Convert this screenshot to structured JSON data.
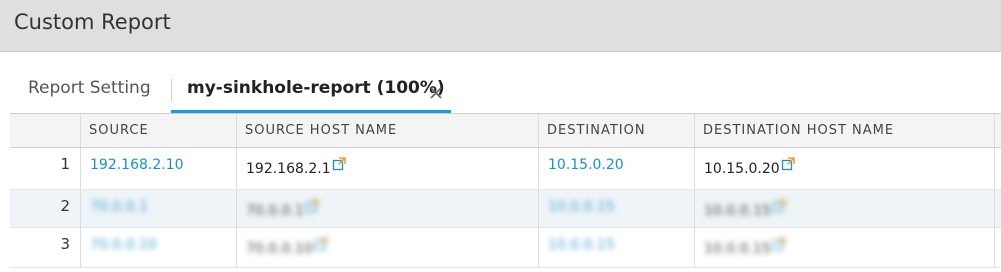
{
  "window": {
    "title": "Custom Report"
  },
  "tabs": {
    "settings_label": "Report Setting",
    "report_label": "my-sinkhole-report (100%)"
  },
  "table": {
    "columns": [
      "SOURCE",
      "SOURCE HOST NAME",
      "DESTINATION",
      "DESTINATION HOST NAME"
    ],
    "rows": [
      {
        "num": "1",
        "source": "192.168.2.10",
        "source_host": "192.168.2.1",
        "destination": "10.15.0.20",
        "dest_host": "10.15.0.20"
      },
      {
        "num": "2",
        "source": "70.0.0.1",
        "source_host": "70.0.0.1",
        "destination": "10.0.0.15",
        "dest_host": "10.0.0.15"
      },
      {
        "num": "3",
        "source": "70.0.0.10",
        "source_host": "70.0.0.10",
        "destination": "10.0.0.15",
        "dest_host": "10.0.0.15"
      }
    ]
  },
  "colors": {
    "accent": "#1c9bd6",
    "link": "#1c8fc7",
    "external_icon": "#e8a33a"
  },
  "icons": {
    "tab_close": "close-icon",
    "external_link": "external-link-icon"
  }
}
